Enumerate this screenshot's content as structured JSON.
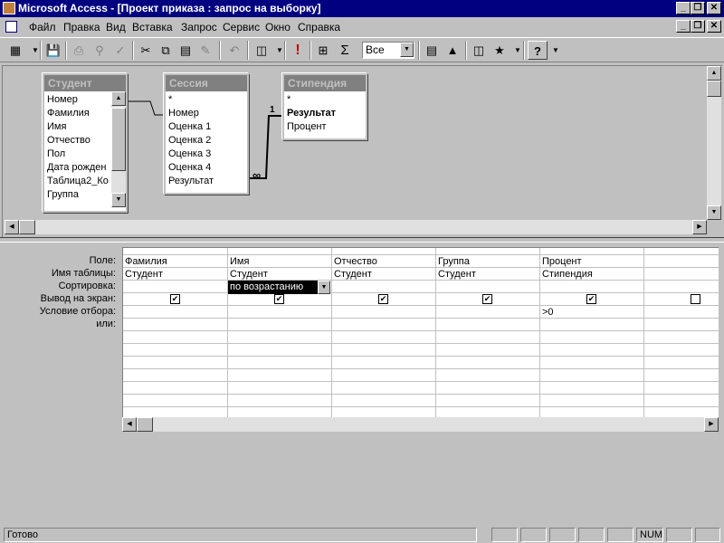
{
  "window": {
    "title": "Microsoft Access - [Проект приказа : запрос на выборку]",
    "btn_minimize": "_",
    "btn_restore": "❐",
    "btn_close": "✕"
  },
  "menu": {
    "items": [
      "Файл",
      "Правка",
      "Вид",
      "Вставка",
      "Запрос",
      "Сервис",
      "Окно",
      "Справка"
    ]
  },
  "toolbar": {
    "top_values": "Все",
    "run_glyph": "!",
    "sum_glyph": "Σ",
    "help_glyph": "?"
  },
  "field_lists": [
    {
      "title": "Студент",
      "fields": [
        "Номер",
        "Фамилия",
        "Имя",
        "Отчество",
        "Пол",
        "Дата рожден",
        "Таблица2_Ко",
        "Группа"
      ]
    },
    {
      "title": "Сессия",
      "fields": [
        "*",
        "Номер",
        "Оценка 1",
        "Оценка 2",
        "Оценка 3",
        "Оценка 4",
        "Результат"
      ]
    },
    {
      "title": "Стипендия",
      "fields": [
        "*",
        "Результат",
        "Процент"
      ]
    }
  ],
  "relationships": {
    "one": "1",
    "many": "∞"
  },
  "qbe": {
    "row_labels": [
      "Поле:",
      "Имя таблицы:",
      "Сортировка:",
      "Вывод на экран:",
      "Условие отбора:",
      "или:"
    ],
    "columns": [
      {
        "field": "Фамилия",
        "table": "Студент",
        "sort": "",
        "show": true,
        "criteria": ""
      },
      {
        "field": "Имя",
        "table": "Студент",
        "sort": "по возрастанию",
        "show": true,
        "criteria": ""
      },
      {
        "field": "Отчество",
        "table": "Студент",
        "sort": "",
        "show": true,
        "criteria": ""
      },
      {
        "field": "Группа",
        "table": "Студент",
        "sort": "",
        "show": true,
        "criteria": ""
      },
      {
        "field": "Процент",
        "table": "Стипендия",
        "sort": "",
        "show": true,
        "criteria": ">0"
      },
      {
        "field": "",
        "table": "",
        "sort": "",
        "show": false,
        "criteria": ""
      }
    ]
  },
  "statusbar": {
    "text": "Готово",
    "num": "NUM"
  }
}
